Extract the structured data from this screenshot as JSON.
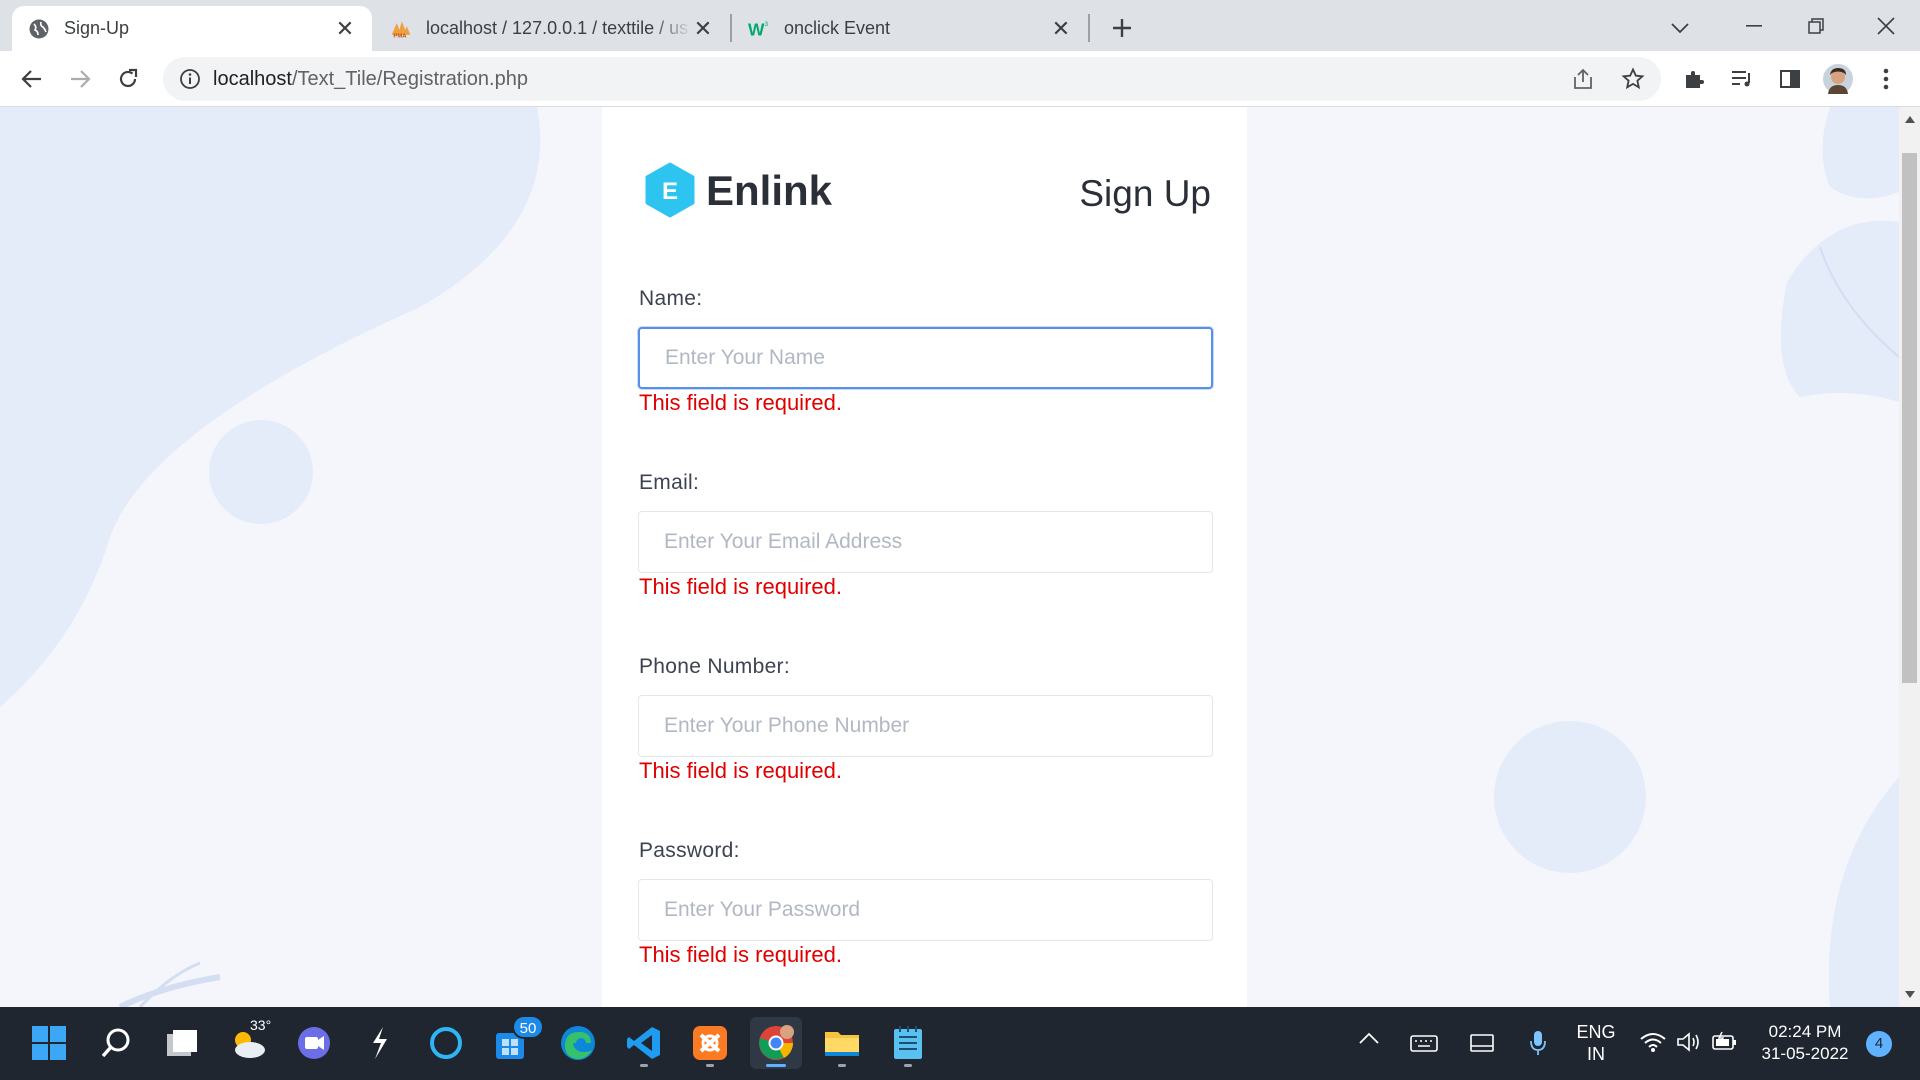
{
  "browser": {
    "tabs": [
      {
        "title": "Sign-Up",
        "icon": "globe-icon",
        "active": true
      },
      {
        "title": "localhost / 127.0.0.1 / texttile / us",
        "icon": "phpmyadmin-icon",
        "active": false
      },
      {
        "title": "onclick Event",
        "icon": "w3schools-icon",
        "active": false
      }
    ],
    "url_host": "localhost",
    "url_path": "/Text_Tile/Registration.php"
  },
  "page": {
    "brand_name": "Enlink",
    "brand_letter": "E",
    "heading": "Sign Up",
    "fields": [
      {
        "label": "Name:",
        "placeholder": "Enter Your Name",
        "error": "This field is required.",
        "focused": true
      },
      {
        "label": "Email:",
        "placeholder": "Enter Your Email Address",
        "error": "This field is required.",
        "focused": false
      },
      {
        "label": "Phone Number:",
        "placeholder": "Enter Your Phone Number",
        "error": "This field is required.",
        "focused": false
      },
      {
        "label": "Password:",
        "placeholder": "Enter Your Password",
        "error": "This field is required.",
        "focused": false
      }
    ]
  },
  "taskbar": {
    "weather_temp": "33°",
    "teams_badge": "50",
    "language_line1": "ENG",
    "language_line2": "IN",
    "time": "02:24 PM",
    "date": "31-05-2022",
    "notification_count": "4"
  },
  "colors": {
    "accent": "#5a8fe6",
    "error": "#e00000",
    "brand_hex": "#2ec4f0",
    "page_bg": "#f4f6fb"
  }
}
